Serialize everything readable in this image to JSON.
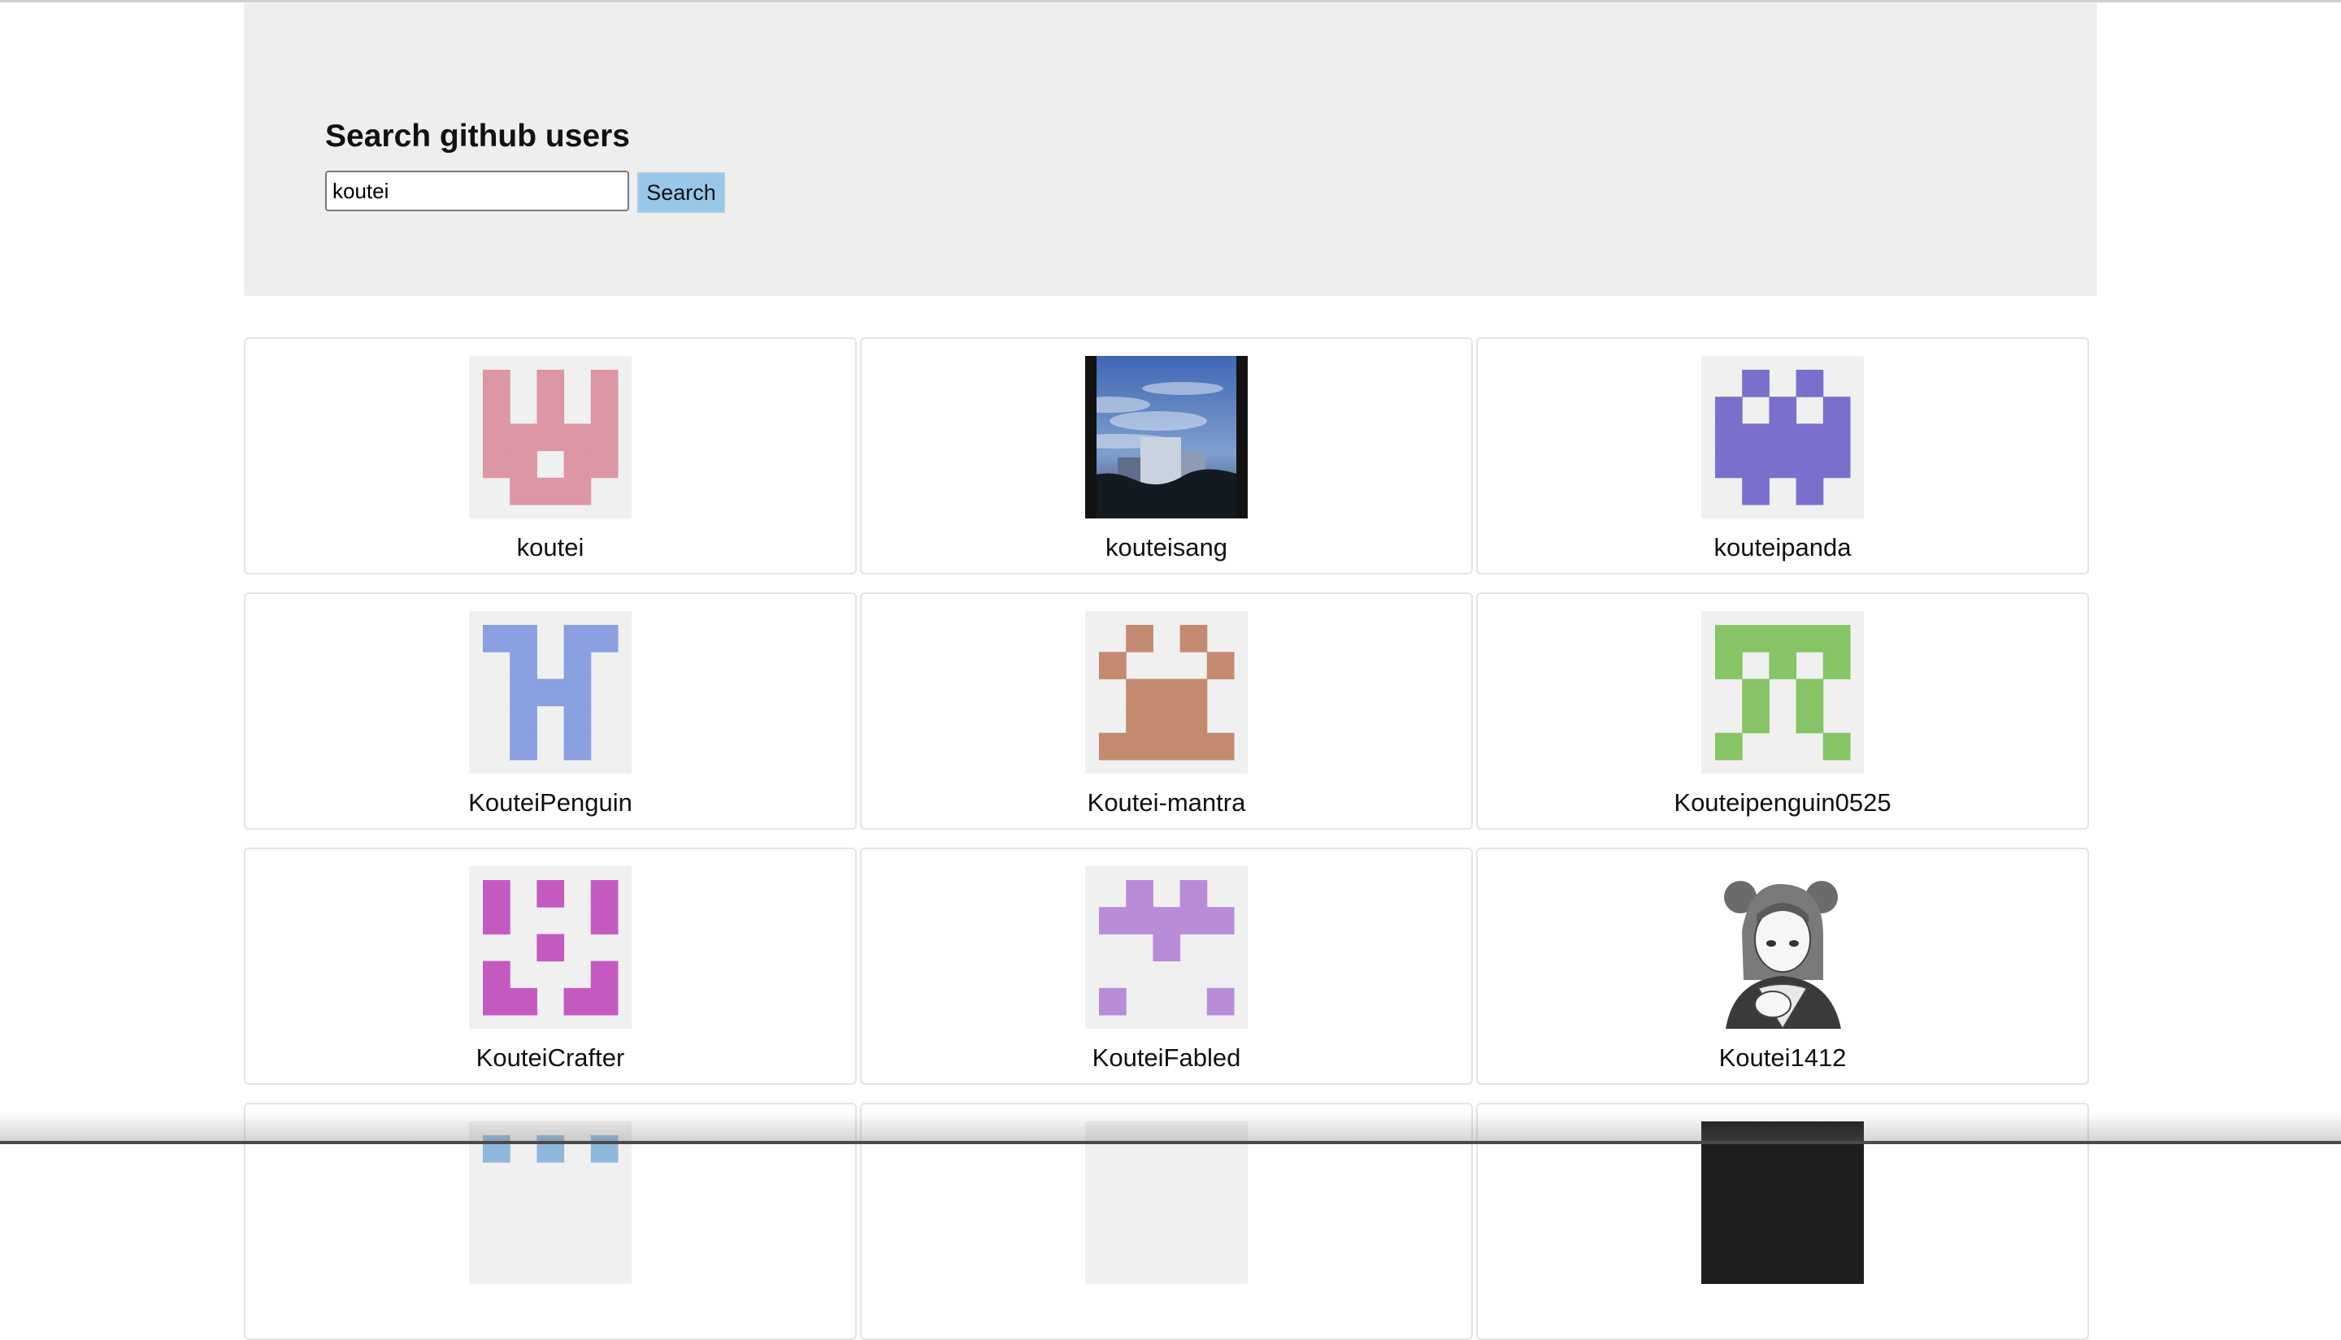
{
  "header": {
    "title": "Search github users",
    "search_value": "koutei",
    "search_button_label": "Search"
  },
  "users": [
    {
      "login": "koutei",
      "avatar": "identicon",
      "color": "#dc96a4",
      "pattern": [
        "10101",
        "10101",
        "11111",
        "11011",
        "01110"
      ]
    },
    {
      "login": "kouteisang",
      "avatar": "photo-city-sky"
    },
    {
      "login": "kouteipanda",
      "avatar": "identicon",
      "color": "#7b6fcd",
      "pattern": [
        "01010",
        "10101",
        "11111",
        "11111",
        "01010"
      ]
    },
    {
      "login": "KouteiPenguin",
      "avatar": "identicon",
      "color": "#8ba0e0",
      "pattern": [
        "11011",
        "01010",
        "01110",
        "01010",
        "01010"
      ]
    },
    {
      "login": "Koutei-mantra",
      "avatar": "identicon",
      "color": "#c48a70",
      "pattern": [
        "01010",
        "10001",
        "01110",
        "01110",
        "11111"
      ]
    },
    {
      "login": "Kouteipenguin0525",
      "avatar": "identicon",
      "color": "#86c466",
      "pattern": [
        "11111",
        "10101",
        "01010",
        "01010",
        "10001"
      ]
    },
    {
      "login": "KouteiCrafter",
      "avatar": "identicon",
      "color": "#c45ac0",
      "pattern": [
        "10101",
        "10001",
        "00100",
        "10001",
        "11011"
      ]
    },
    {
      "login": "KouteiFabled",
      "avatar": "identicon",
      "color": "#b98cd8",
      "pattern": [
        "01010",
        "11111",
        "00100",
        "00000",
        "10001"
      ]
    },
    {
      "login": "Koutei1412",
      "avatar": "illustration-anime-girl"
    },
    {
      "login": "",
      "avatar": "identicon",
      "color": "#8fb8dc",
      "pattern": [
        "10101",
        "00000",
        "00000",
        "00000",
        "00000"
      ]
    },
    {
      "login": "",
      "avatar": "identicon",
      "color": "#a9d98c",
      "pattern": [
        "00000",
        "00000",
        "00000",
        "00000",
        "00000"
      ]
    },
    {
      "login": "",
      "avatar": "dark-image"
    }
  ]
}
